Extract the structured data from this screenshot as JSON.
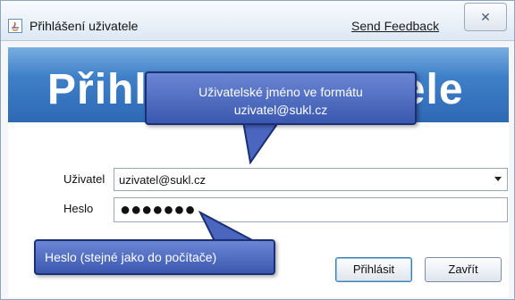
{
  "window": {
    "title": "Přihlášení uživatele",
    "feedback_link": "Send Feedback",
    "close_glyph": "✕"
  },
  "banner": {
    "title": "Přihlášení uživatele"
  },
  "form": {
    "user_label": "Uživatel",
    "user_value": "uzivatel@sukl.cz",
    "password_label": "Heslo",
    "password_mask": "●●●●●●●"
  },
  "buttons": {
    "login": "Přihlásit",
    "close": "Zavřít"
  },
  "tooltips": {
    "user_line1": "Uživatelské jméno ve formátu",
    "user_line2": "uzivatel@sukl.cz",
    "password": "Heslo (stejné jako do počítače)"
  },
  "colors": {
    "banner": "#3f7fc8",
    "tooltip": "#4a66bf",
    "tooltip_border": "#1b2f75"
  }
}
